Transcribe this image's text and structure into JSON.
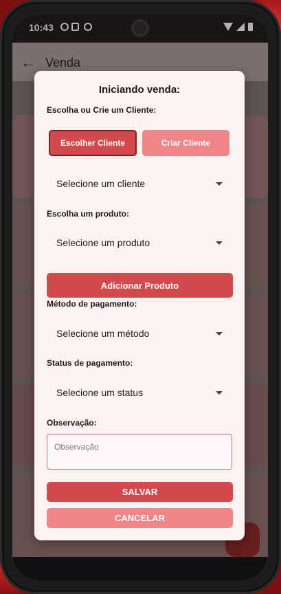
{
  "status_bar": {
    "time": "10:43"
  },
  "appbar": {
    "back_icon": "arrow-left-icon",
    "title": "Venda"
  },
  "dialog": {
    "title": "Iniciando venda:",
    "client_label": "Escolha ou Crie um Cliente:",
    "choose_client_button": "Escolher Cliente",
    "create_client_button": "Criar Cliente",
    "client_select": "Selecione um cliente",
    "product_label": "Escolha um produto:",
    "product_select": "Selecione um produto",
    "add_product_button": "Adicionar Produto",
    "payment_method_label": "Método de pagamento:",
    "payment_method_select": "Selecione um método",
    "payment_status_label": "Status de pagamento:",
    "payment_status_select": "Selecione um status",
    "notes_label": "Observação:",
    "notes_placeholder": "Observação",
    "save_button": "SALVAR",
    "cancel_button": "CANCELAR"
  },
  "colors": {
    "primary": "#d34a4d",
    "primary_light": "#ef8589",
    "dialog_bg": "#fdf2f2"
  }
}
